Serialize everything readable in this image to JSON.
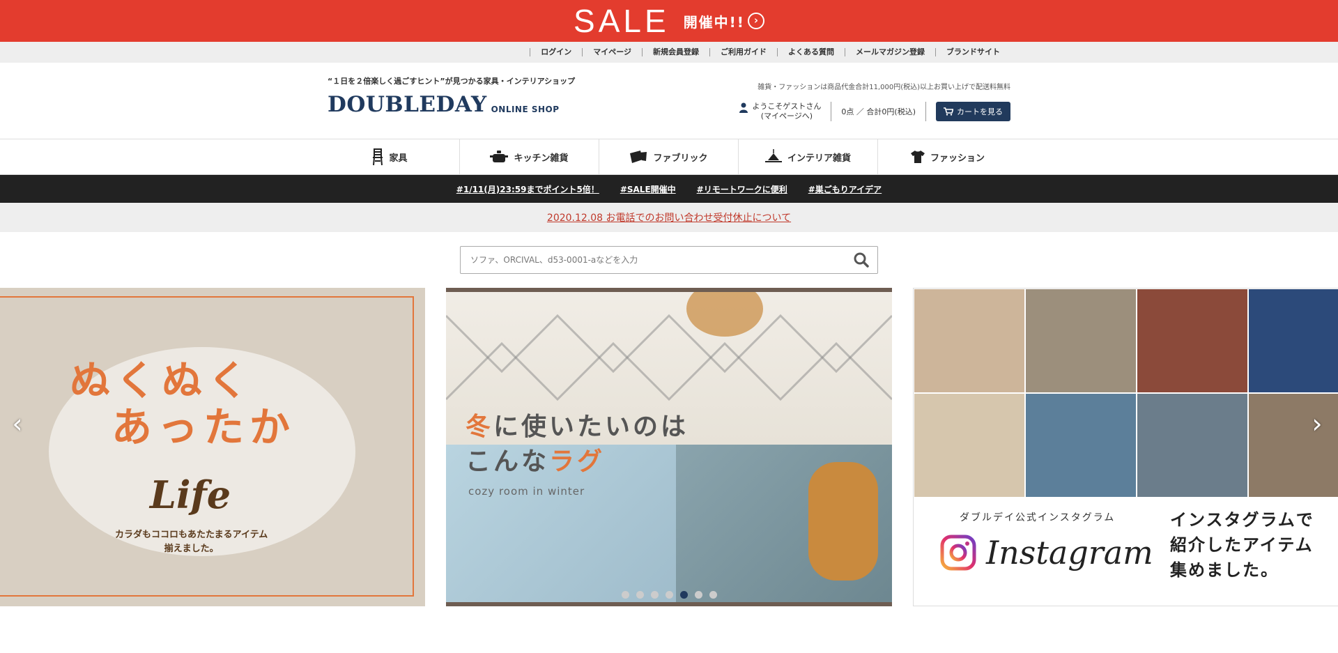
{
  "sale_banner": {
    "big": "SALE",
    "small": "開催中!!",
    "arrow": "›"
  },
  "util_links": [
    "ログイン",
    "マイページ",
    "新規会員登録",
    "ご利用ガイド",
    "よくある質問",
    "メールマガジン登録",
    "ブランドサイト"
  ],
  "header": {
    "tagline": "“１日を２倍楽しく過ごすヒント”が見つかる家具・インテリアショップ",
    "logo_main": "DOUBLEDAY",
    "logo_sub": "ONLINE SHOP",
    "shipping_note": "雑貨・ファッションは商品代金合計11,000円(税込)以上お買い上げで配送料無料",
    "user_line1": "ようこそゲストさん",
    "user_line2": "(マイページへ)",
    "cart_info": "0点 ／ 合計0円(税込)",
    "cart_button": "カートを見る"
  },
  "categories": [
    {
      "label": "家具",
      "icon": "chair-icon"
    },
    {
      "label": "キッチン雑貨",
      "icon": "pot-icon"
    },
    {
      "label": "ファブリック",
      "icon": "cushion-icon"
    },
    {
      "label": "インテリア雑貨",
      "icon": "lamp-icon"
    },
    {
      "label": "ファッション",
      "icon": "tshirt-icon"
    }
  ],
  "hashtags": [
    "#1/11(月)23:59までポイント5倍！",
    "#SALE開催中",
    "#リモートワークに便利",
    "#巣ごもりアイデア"
  ],
  "notice": "2020.12.08 お電話でのお問い合わせ受付休止について",
  "search": {
    "placeholder": "ソファ、ORCIVAL、d53-0001-aなどを入力"
  },
  "slides": {
    "s1": {
      "line1": "ぬくぬく",
      "line2": "あったか",
      "life": "Life",
      "sub1": "カラダもココロもあたたまるアイテム",
      "sub2": "揃えました。"
    },
    "s2": {
      "line1a": "冬",
      "line1b": "に使いたいのは",
      "line2a": "こんな",
      "line2b": "ラグ",
      "cozy": "cozy room in winter"
    },
    "s3": {
      "small": "ダブルデイ公式インスタグラム",
      "name": "Instagram",
      "r1": "インスタグラムで",
      "r2": "紹介したアイテム",
      "r3": "集めました。"
    }
  },
  "carousel": {
    "prev": "‹",
    "next": "›",
    "dot_count": 7,
    "active_dot": 5
  },
  "colors": {
    "sale_red": "#e33c2e",
    "brand_navy": "#203a5e",
    "accent_orange": "#e2763b"
  }
}
